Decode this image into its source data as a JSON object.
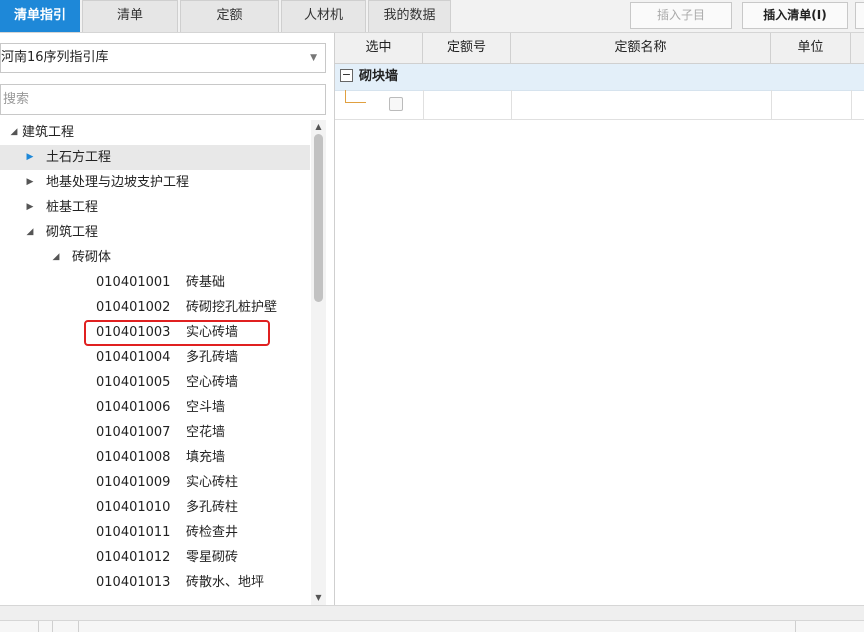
{
  "tabs": [
    {
      "label": "清单指引",
      "active": true
    },
    {
      "label": "清单"
    },
    {
      "label": "定额"
    },
    {
      "label": "人材机"
    },
    {
      "label": "我的数据"
    }
  ],
  "toolbar": {
    "insert_child_label": "插入子目",
    "insert_list_label": "插入清单(I)"
  },
  "left_panel": {
    "library_select": "河南16序列指引库",
    "search_placeholder": "搜索"
  },
  "tree": [
    {
      "label": "建筑工程",
      "level": 0,
      "state": "expanded"
    },
    {
      "label": "土石方工程",
      "level": 1,
      "state": "collapsed",
      "selected": true
    },
    {
      "label": "地基处理与边坡支护工程",
      "level": 1,
      "state": "collapsed"
    },
    {
      "label": "桩基工程",
      "level": 1,
      "state": "collapsed"
    },
    {
      "label": "砌筑工程",
      "level": 1,
      "state": "expanded"
    },
    {
      "label": "砖砌体",
      "level": 2,
      "state": "expanded"
    },
    {
      "code": "010401001",
      "label": "砖基础",
      "level": 3
    },
    {
      "code": "010401002",
      "label": "砖砌挖孔桩护壁",
      "level": 3
    },
    {
      "code": "010401003",
      "label": "实心砖墙",
      "level": 3,
      "highlighted": true
    },
    {
      "code": "010401004",
      "label": "多孔砖墙",
      "level": 3
    },
    {
      "code": "010401005",
      "label": "空心砖墙",
      "level": 3
    },
    {
      "code": "010401006",
      "label": "空斗墙",
      "level": 3
    },
    {
      "code": "010401007",
      "label": "空花墙",
      "level": 3
    },
    {
      "code": "010401008",
      "label": "填充墙",
      "level": 3
    },
    {
      "code": "010401009",
      "label": "实心砖柱",
      "level": 3
    },
    {
      "code": "010401010",
      "label": "多孔砖柱",
      "level": 3
    },
    {
      "code": "010401011",
      "label": "砖检查井",
      "level": 3
    },
    {
      "code": "010401012",
      "label": "零星砌砖",
      "level": 3
    },
    {
      "code": "010401013",
      "label": "砖散水、地坪",
      "level": 3
    }
  ],
  "grid": {
    "columns": [
      "选中",
      "定额号",
      "定额名称",
      "单位"
    ],
    "group_label": "砌块墙",
    "group_toggle": "−"
  },
  "icons": {
    "expanded": "triangle-down-right",
    "collapsed": "triangle-right",
    "caret": "chevron-down"
  },
  "colors": {
    "accent": "#1e88d8",
    "highlight_border": "#e02020",
    "group_row_bg": "#e3eff9"
  }
}
